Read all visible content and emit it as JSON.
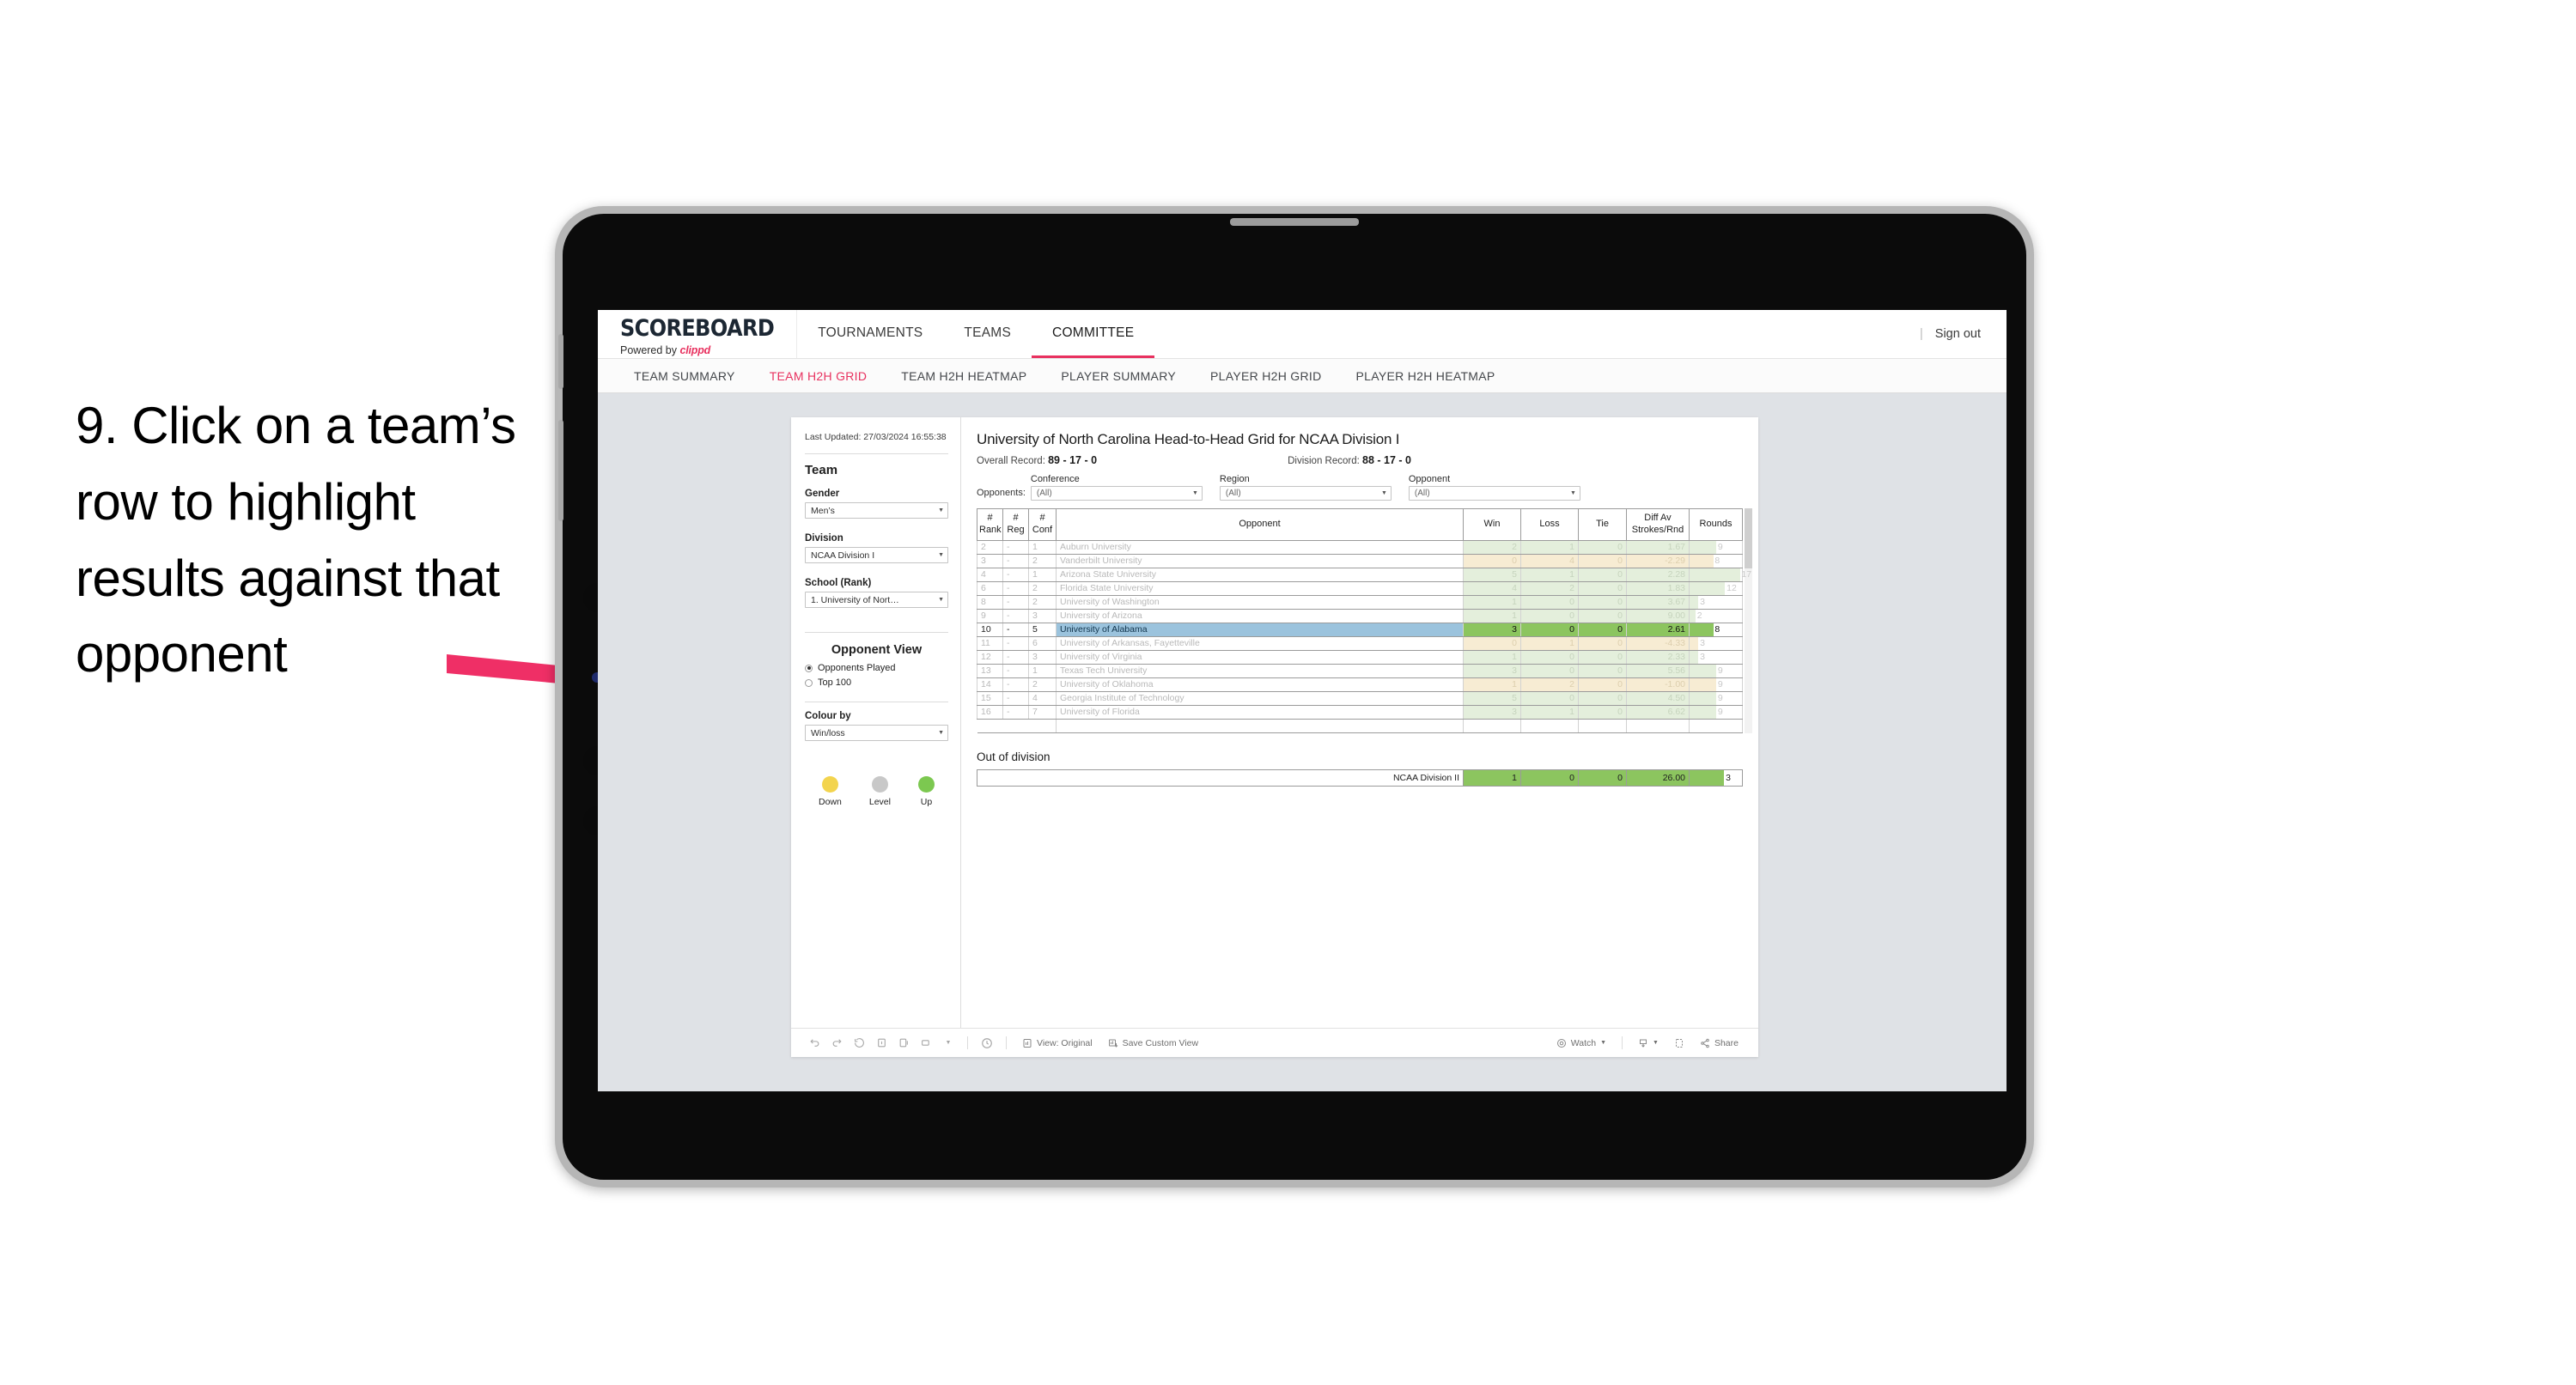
{
  "instruction": "9. Click on a team’s row to highlight results against that opponent",
  "colors": {
    "accent_pink": "#e8315f",
    "arrow": "#ef2f66",
    "select_blue": "#9bc3dd",
    "green_bar": "#8cc55f",
    "green_tint": "#e4efdc",
    "yellow_tint": "#f7ecd3",
    "legend_down": "#f3d44e",
    "legend_level": "#c8c8c8",
    "legend_up": "#7cc850"
  },
  "header": {
    "brand_name": "SCOREBOARD",
    "brand_sub_prefix": "Powered by ",
    "brand_sub_name": "clippd",
    "nav": [
      {
        "label": "TOURNAMENTS",
        "active": false
      },
      {
        "label": "TEAMS",
        "active": false
      },
      {
        "label": "COMMITTEE",
        "active": true
      }
    ],
    "separator": "|",
    "sign_out": "Sign out"
  },
  "subnav": [
    {
      "label": "TEAM SUMMARY",
      "active": false
    },
    {
      "label": "TEAM H2H GRID",
      "active": true
    },
    {
      "label": "TEAM H2H HEATMAP",
      "active": false
    },
    {
      "label": "PLAYER SUMMARY",
      "active": false
    },
    {
      "label": "PLAYER H2H GRID",
      "active": false
    },
    {
      "label": "PLAYER H2H HEATMAP",
      "active": false
    }
  ],
  "sidebar": {
    "last_updated": "Last Updated: 27/03/2024 16:55:38",
    "team_heading": "Team",
    "gender_label": "Gender",
    "gender_value": "Men’s",
    "division_label": "Division",
    "division_value": "NCAA Division I",
    "school_label": "School (Rank)",
    "school_value": "1. University of Nort…",
    "opponent_view_heading": "Opponent View",
    "opponent_view_options": [
      {
        "label": "Opponents Played",
        "selected": true
      },
      {
        "label": "Top 100",
        "selected": false
      }
    ],
    "colour_by_label": "Colour by",
    "colour_by_value": "Win/loss",
    "legend": [
      {
        "label": "Down",
        "color": "#f3d44e"
      },
      {
        "label": "Level",
        "color": "#c8c8c8"
      },
      {
        "label": "Up",
        "color": "#7cc850"
      }
    ]
  },
  "main": {
    "title": "University of North Carolina Head-to-Head Grid for NCAA Division I",
    "overall_record_label": "Overall Record: ",
    "overall_record_value": "89 - 17 - 0",
    "division_record_label": "Division Record: ",
    "division_record_value": "88 - 17 - 0",
    "filters_lead": "Opponents:",
    "filters": [
      {
        "label": "Conference",
        "value": "(All)"
      },
      {
        "label": "Region",
        "value": "(All)"
      },
      {
        "label": "Opponent",
        "value": "(All)"
      }
    ]
  },
  "chart_data": {
    "type": "table",
    "title": "University of North Carolina Head-to-Head Grid for NCAA Division I",
    "columns": [
      "# Rank",
      "# Reg",
      "# Conf",
      "Opponent",
      "Win",
      "Loss",
      "Tie",
      "Diff Av Strokes/Rnd",
      "Rounds"
    ],
    "rows": [
      {
        "rank": "2",
        "reg": "-",
        "conf": "1",
        "opponent": "Auburn University",
        "win": "2",
        "loss": "1",
        "tie": "0",
        "diff": "1.67",
        "rounds": "9",
        "tone": "up",
        "selected": false
      },
      {
        "rank": "3",
        "reg": "-",
        "conf": "2",
        "opponent": "Vanderbilt University",
        "win": "0",
        "loss": "4",
        "tie": "0",
        "diff": "-2.29",
        "rounds": "8",
        "tone": "down",
        "selected": false
      },
      {
        "rank": "4",
        "reg": "-",
        "conf": "1",
        "opponent": "Arizona State University",
        "win": "5",
        "loss": "1",
        "tie": "0",
        "diff": "2.28",
        "rounds": "17",
        "tone": "up",
        "selected": false
      },
      {
        "rank": "6",
        "reg": "-",
        "conf": "2",
        "opponent": "Florida State University",
        "win": "4",
        "loss": "2",
        "tie": "0",
        "diff": "1.83",
        "rounds": "12",
        "tone": "up",
        "selected": false
      },
      {
        "rank": "8",
        "reg": "-",
        "conf": "2",
        "opponent": "University of Washington",
        "win": "1",
        "loss": "0",
        "tie": "0",
        "diff": "3.67",
        "rounds": "3",
        "tone": "up",
        "selected": false
      },
      {
        "rank": "9",
        "reg": "-",
        "conf": "3",
        "opponent": "University of Arizona",
        "win": "1",
        "loss": "0",
        "tie": "0",
        "diff": "9.00",
        "rounds": "2",
        "tone": "up",
        "selected": false
      },
      {
        "rank": "10",
        "reg": "-",
        "conf": "5",
        "opponent": "University of Alabama",
        "win": "3",
        "loss": "0",
        "tie": "0",
        "diff": "2.61",
        "rounds": "8",
        "tone": "up",
        "selected": true
      },
      {
        "rank": "11",
        "reg": "-",
        "conf": "6",
        "opponent": "University of Arkansas, Fayetteville",
        "win": "0",
        "loss": "1",
        "tie": "0",
        "diff": "-4.33",
        "rounds": "3",
        "tone": "down",
        "selected": false
      },
      {
        "rank": "12",
        "reg": "-",
        "conf": "3",
        "opponent": "University of Virginia",
        "win": "1",
        "loss": "0",
        "tie": "0",
        "diff": "2.33",
        "rounds": "3",
        "tone": "up",
        "selected": false
      },
      {
        "rank": "13",
        "reg": "-",
        "conf": "1",
        "opponent": "Texas Tech University",
        "win": "3",
        "loss": "0",
        "tie": "0",
        "diff": "5.56",
        "rounds": "9",
        "tone": "up",
        "selected": false
      },
      {
        "rank": "14",
        "reg": "-",
        "conf": "2",
        "opponent": "University of Oklahoma",
        "win": "1",
        "loss": "2",
        "tie": "0",
        "diff": "-1.00",
        "rounds": "9",
        "tone": "down",
        "selected": false
      },
      {
        "rank": "15",
        "reg": "-",
        "conf": "4",
        "opponent": "Georgia Institute of Technology",
        "win": "5",
        "loss": "0",
        "tie": "0",
        "diff": "4.50",
        "rounds": "9",
        "tone": "up",
        "selected": false
      },
      {
        "rank": "16",
        "reg": "-",
        "conf": "7",
        "opponent": "University of Florida",
        "win": "3",
        "loss": "1",
        "tie": "0",
        "diff": "6.62",
        "rounds": "9",
        "tone": "up",
        "selected": false
      }
    ],
    "out_of_division": {
      "heading": "Out of division",
      "label": "NCAA Division II",
      "win": "1",
      "loss": "0",
      "tie": "0",
      "diff": "26.00",
      "rounds": "3"
    }
  },
  "toolbar": {
    "icons": [
      "undo-icon",
      "redo-icon",
      "revert-icon",
      "pause-icon",
      "pause-auto-updates-icon",
      "device-layout-icon",
      "refresh-icon"
    ],
    "view_label": "View: Original",
    "save_view_label": "Save Custom View",
    "watch_label": "Watch",
    "share_label": "Share"
  }
}
